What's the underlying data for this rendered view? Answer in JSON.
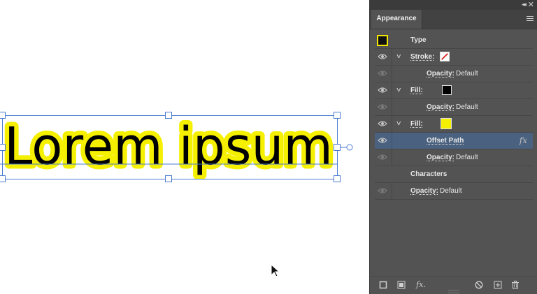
{
  "artwork": {
    "text": "Lorem ipsum",
    "fill_color": "#000000",
    "offset_color": "#f5ef00",
    "selection_color": "#4a7bd0"
  },
  "panel": {
    "tab_label": "Appearance",
    "collapse_glyph": "◂◂",
    "close_glyph": "✕",
    "rows": {
      "type": {
        "label": "Type"
      },
      "stroke": {
        "label": "Stroke:",
        "swatch": "none-red-slash"
      },
      "stroke_opacity": {
        "label": "Opacity:",
        "value": "Default"
      },
      "fill1": {
        "label": "Fill:",
        "swatch_color": "#000000"
      },
      "fill1_opacity": {
        "label": "Opacity:",
        "value": "Default"
      },
      "fill2": {
        "label": "Fill:",
        "swatch_color": "#f5ef00"
      },
      "offset_path": {
        "label": "Offset Path",
        "fx": "fx"
      },
      "fill2_opacity": {
        "label": "Opacity:",
        "value": "Default"
      },
      "characters": {
        "label": "Characters"
      },
      "opacity": {
        "label": "Opacity:",
        "value": "Default"
      }
    },
    "bottom": {
      "add_stroke_icon": "add-new-stroke-icon",
      "add_fill_icon": "add-new-fill-icon",
      "fx_label": "fx.",
      "clear_icon": "clear-appearance-icon",
      "duplicate_icon": "duplicate-item-icon",
      "delete_icon": "delete-item-icon"
    }
  }
}
